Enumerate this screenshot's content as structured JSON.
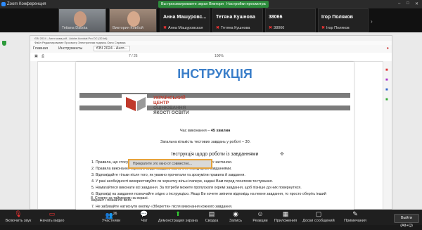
{
  "app": {
    "title": "Zoom Конференция"
  },
  "banner": {
    "share_text": "Вы просматриваете экран Виктории Ковбой",
    "view_settings": "Настройки просмотра"
  },
  "participants": [
    {
      "name": "Tetiana Datska",
      "has_video": true
    },
    {
      "name": "Виктория Ковбой",
      "has_video": true
    },
    {
      "name": "Анна Машуровс...",
      "sub": "Анна Машуровская"
    },
    {
      "name": "Тетяна Кушнова",
      "sub": "Тетяна Кушнова"
    },
    {
      "name": "38066",
      "sub": "38066"
    },
    {
      "name": "Ігор Поляков",
      "sub": "Ігор Поляков"
    }
  ],
  "acrobat": {
    "window_title": "ЄВІ 2024 - Англ мова.pdf - Adobe Acrobat Pro DC (32-bit)",
    "menu": "Файл   Редактирование   Просмотр   Электронная подпись   Окно   Справка",
    "tabs": [
      "Главная",
      "Инструменты",
      "ЄВІ 2024 - Англ..."
    ],
    "page_indicator": "7 / 25",
    "zoom": "100%"
  },
  "document": {
    "title": "ІНСТРУКЦІЯ",
    "brand_line1": "УКРАЇНСЬКИЙ",
    "brand_line2": "ЦЕНТР",
    "brand_line3": "ОЦІНЮВАННЯ",
    "brand_line4": "ЯКОСТІ ОСВІТИ",
    "time_label": "Час виконання – ",
    "time_value": "45 хвилин",
    "task_count": "Загальна кількість тестових завдань у роботі – 30.",
    "subtitle": "Інструкція щодо роботи із завданнями",
    "items": [
      "1. Правила, що стосуються всієї частини, зазначені перед відповідною частиною.",
      "2. Правила виконання окремих видів завдань зазначені перед цими завданнями.",
      "3. Відповідайте тільки після того, як уважно прочитали та зрозуміли правила й завдання.",
      "4. У разі необхідності використовуйте як чернетку вільні папери, надані Вам перед початком тестування.",
      "5. Намагайтеся виконати всі завдання. За потреби можете пропускати окремі завдання, щоб пізніше до них повернутися.",
      "6. Відповіді на завдання позначайте згідно з інструкцією. Якщо Ви хочете змінити відповідь на певне завдання, то просто оберіть інший",
      "    варіант і позначте його.",
      "7. Не забувайте натиснути кнопку «Зберегти» після виконання кожного завдання.",
      "8. Стежте за таймером на екрані."
    ],
    "stop_label": "Прекратите это окно от совместно..."
  },
  "toolbar": {
    "items": [
      {
        "label": "Включить звук",
        "icon": "mic-muted-icon"
      },
      {
        "label": "Начать видео",
        "icon": "video-off-icon"
      },
      {
        "label": "Участники",
        "icon": "participants-icon",
        "count": "26"
      },
      {
        "label": "Чат",
        "icon": "chat-icon"
      },
      {
        "label": "Демонстрация экрана",
        "icon": "share-screen-icon"
      },
      {
        "label": "Сводка",
        "icon": "summary-icon"
      },
      {
        "label": "Запись",
        "icon": "record-icon"
      },
      {
        "label": "Реакции",
        "icon": "reactions-icon"
      },
      {
        "label": "Приложения",
        "icon": "apps-icon"
      },
      {
        "label": "Доски сообщений",
        "icon": "whiteboard-icon"
      },
      {
        "label": "Примечания",
        "icon": "notes-icon"
      }
    ],
    "end_label": "Выйти (Alt+Q)"
  },
  "colors": {
    "accent": "#2d8cff",
    "share_green": "#2d8c3c",
    "doc_title": "#3a7ec9",
    "brand_red": "#c0392b",
    "highlight": "#e7a33b"
  }
}
